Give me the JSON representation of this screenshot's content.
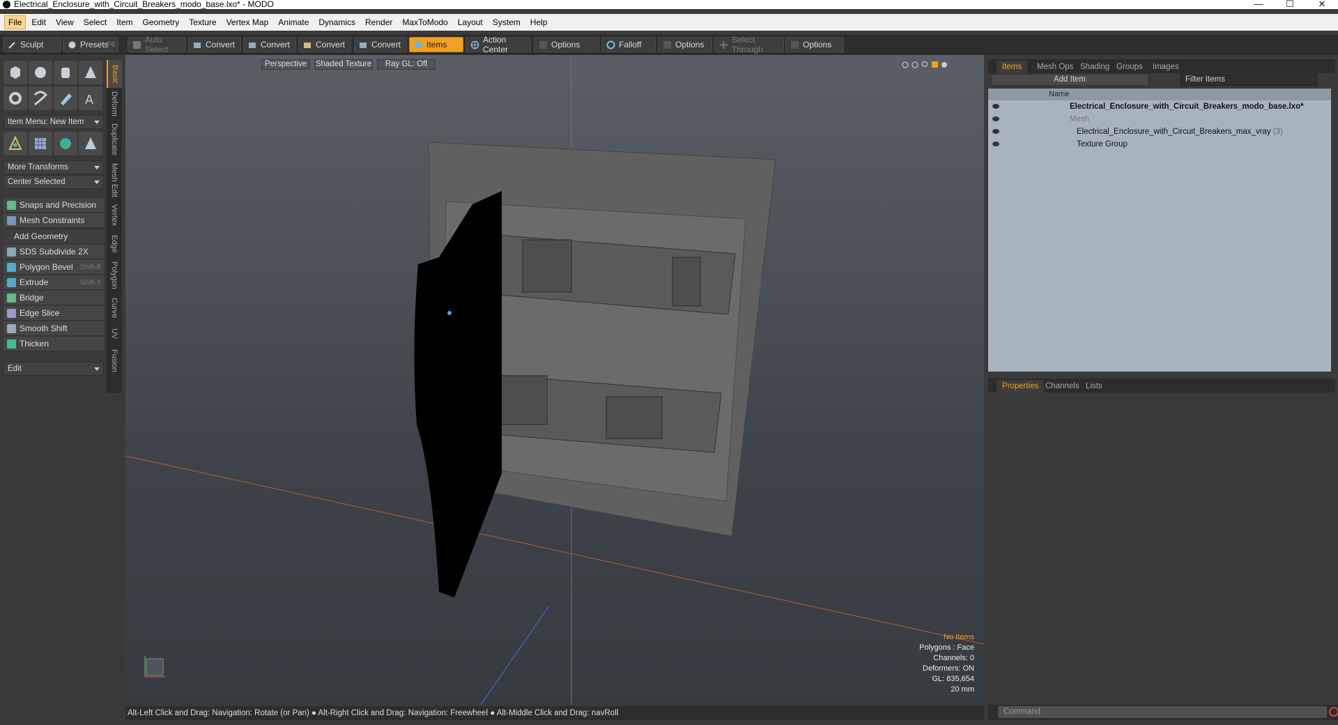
{
  "window": {
    "title": "Electrical_Enclosure_with_Circuit_Breakers_modo_base.lxo* - MODO",
    "minimize": "—",
    "maximize": "☐",
    "close": "✕"
  },
  "menu": [
    "File",
    "Edit",
    "View",
    "Select",
    "Item",
    "Geometry",
    "Texture",
    "Vertex Map",
    "Animate",
    "Dynamics",
    "Render",
    "MaxToModo",
    "Layout",
    "System",
    "Help"
  ],
  "toolbar": {
    "sculpt": "Sculpt",
    "presets": "Presets",
    "presets_key": "F6",
    "auto_select": "Auto Select",
    "convert1": "Convert",
    "convert2": "Convert",
    "convert3": "Convert",
    "convert4": "Convert",
    "items": "Items",
    "action_center": "Action Center",
    "options1": "Options",
    "falloff": "Falloff",
    "options2": "Options",
    "select_through": "Select Through",
    "options3": "Options"
  },
  "left_panel": {
    "vtabs": [
      "Basic",
      "Deform",
      "Duplicate",
      "Mesh Edit",
      "Vertex",
      "Edge",
      "Polygon",
      "Curve",
      "UV",
      "Fusion"
    ],
    "item_menu": "Item Menu: New Item",
    "more_transforms": "More Transforms",
    "center_selected": "Center Selected",
    "snaps": "Snaps and Precision",
    "mesh_constraints": "Mesh Constraints",
    "add_geometry": "Add Geometry",
    "tools": [
      {
        "label": "SDS Subdivide 2X",
        "key": ""
      },
      {
        "label": "Polygon Bevel",
        "key": "Shift-B"
      },
      {
        "label": "Extrude",
        "key": "Shift-X"
      },
      {
        "label": "Bridge",
        "key": ""
      },
      {
        "label": "Edge Slice",
        "key": ""
      },
      {
        "label": "Smooth Shift",
        "key": ""
      },
      {
        "label": "Thicken",
        "key": ""
      }
    ],
    "edit_drop": "Edit"
  },
  "viewport": {
    "perspective": "Perspective",
    "shading": "Shaded Texture",
    "raygl": "Ray GL: Off",
    "stats": {
      "no_items": "No Items",
      "polygons": "Polygons : Face",
      "channels": "Channels: 0",
      "deformers": "Deformers: ON",
      "gl": "GL: 835,654",
      "scale": "20 mm"
    }
  },
  "status": {
    "hint": "Alt-Left Click and Drag: Navigation: Rotate (or Pan) ● Alt-Right Click and Drag: Navigation: Freewheel ● Alt-Middle Click and Drag: navRoll"
  },
  "right_panel": {
    "top_tabs": [
      "Items",
      "Mesh Ops",
      "Shading",
      "Groups",
      "Images"
    ],
    "add_item": "Add Item",
    "filter_placeholder": "Filter Items",
    "col_name": "Name",
    "items": [
      {
        "label": "Electrical_Enclosure_with_Circuit_Breakers_modo_base.lxo*"
      },
      {
        "label": "Mesh"
      },
      {
        "label": "Electrical_Enclosure_with_Circuit_Breakers_max_vray",
        "count": "(3)"
      },
      {
        "label": "Texture Group"
      }
    ],
    "bottom_tabs": [
      "Properties",
      "Channels",
      "Lists"
    ],
    "command_placeholder": "Command"
  },
  "colors": {
    "accent": "#f0a022",
    "panel": "#3a3a3a",
    "viewport": "#4a5056"
  }
}
